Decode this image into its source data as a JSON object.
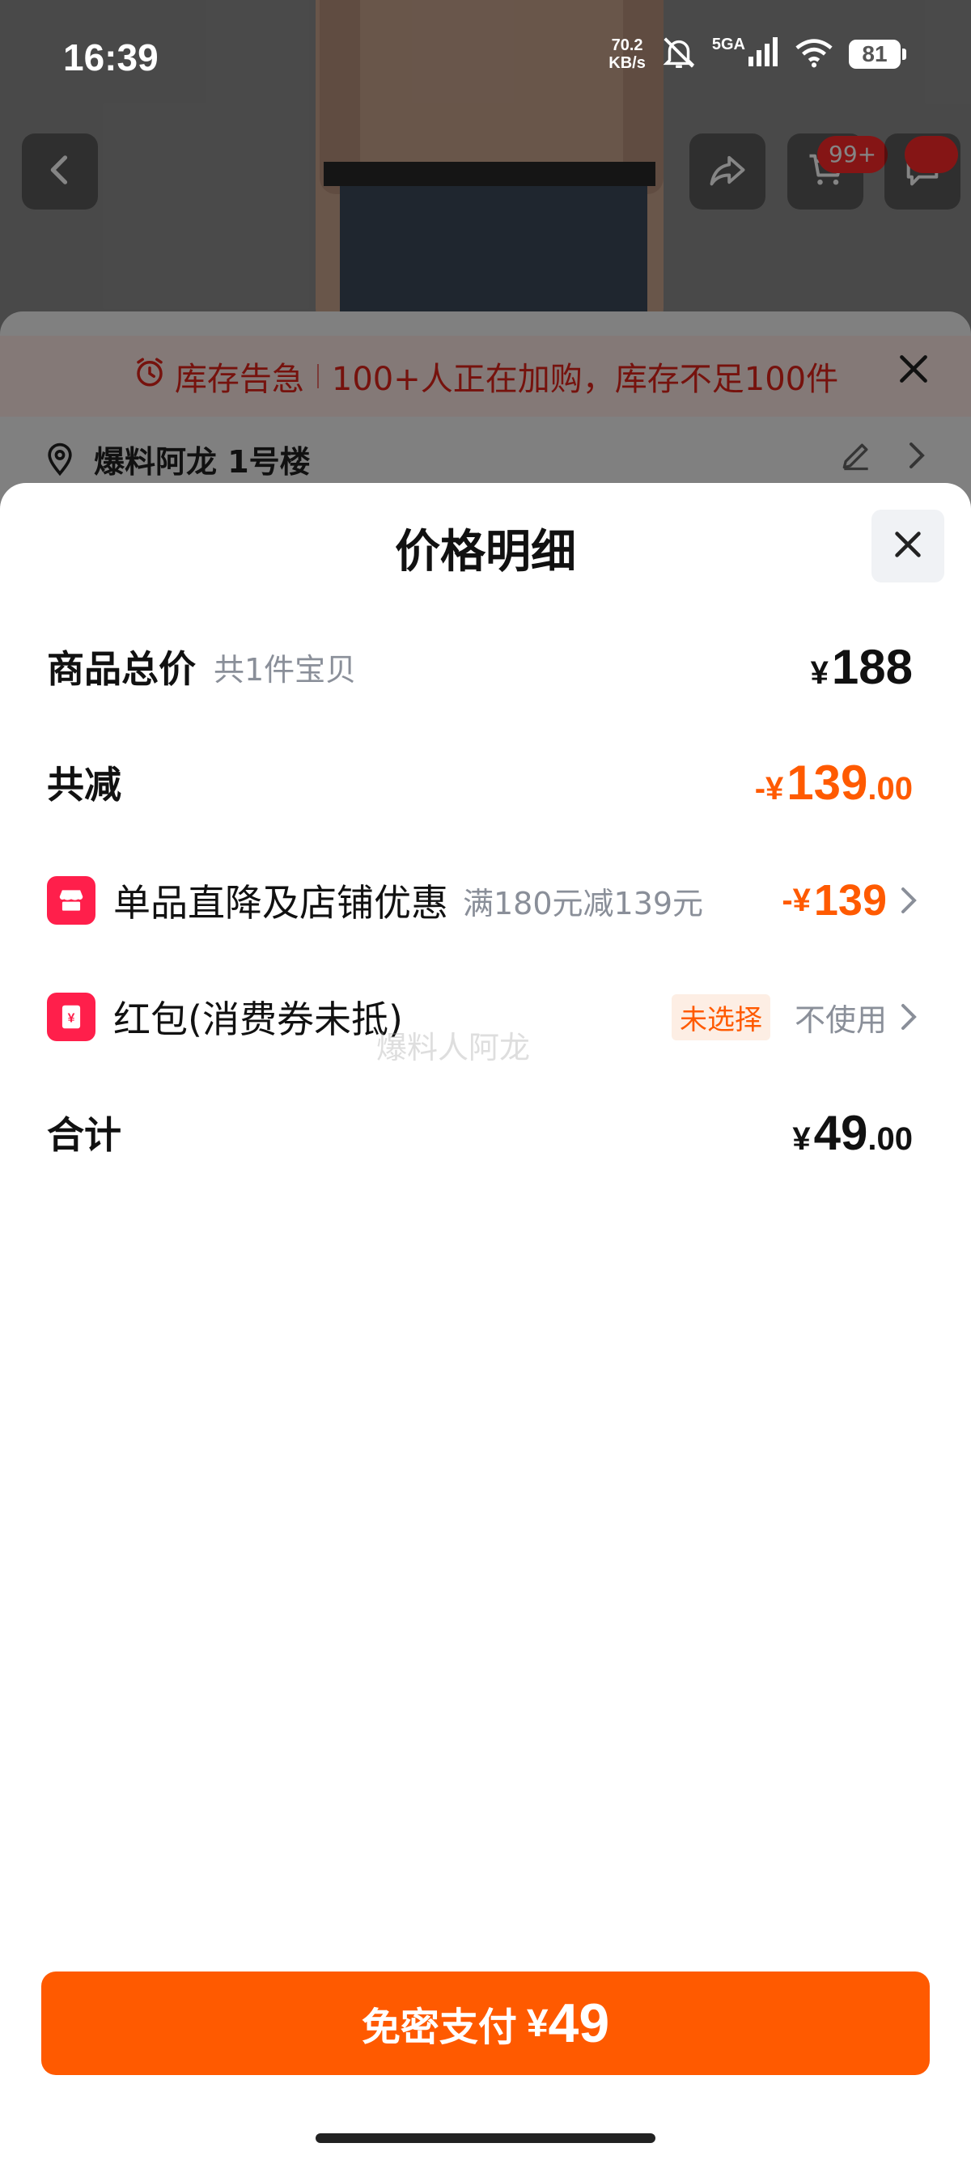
{
  "status_bar": {
    "time": "16:39",
    "net_speed_value": "70.2",
    "net_speed_unit": "KB/s",
    "signal_label": "5GA",
    "battery": "81"
  },
  "background": {
    "cart_badge": "99+",
    "stock_alert": {
      "title": "库存告急",
      "message": "100+人正在加购，库存不足100件"
    },
    "address": "爆料阿龙 1号楼"
  },
  "sheet": {
    "title": "价格明细",
    "rows": {
      "total": {
        "label": "商品总价",
        "sub": "共1件宝贝",
        "yen": "¥",
        "amount": "188"
      },
      "discount": {
        "label": "共减",
        "prefix": "-¥",
        "amount": "139",
        "decimal": ".00"
      },
      "shop": {
        "label": "单品直降及店铺优惠",
        "sub": "满180元减139元",
        "prefix": "-¥",
        "amount": "139"
      },
      "redpacket": {
        "label": "红包(消费券未抵)",
        "tag": "未选择",
        "status": "不使用"
      },
      "sum": {
        "label": "合计",
        "yen": "¥",
        "amount": "49",
        "decimal": ".00"
      }
    },
    "watermark": "爆料人阿龙",
    "pay_button": {
      "label": "免密支付",
      "yen": "¥",
      "amount": "49"
    }
  },
  "colors": {
    "accent": "#ff5a00",
    "icon_red": "#ff1f4b",
    "alert_red": "#e2231a"
  }
}
